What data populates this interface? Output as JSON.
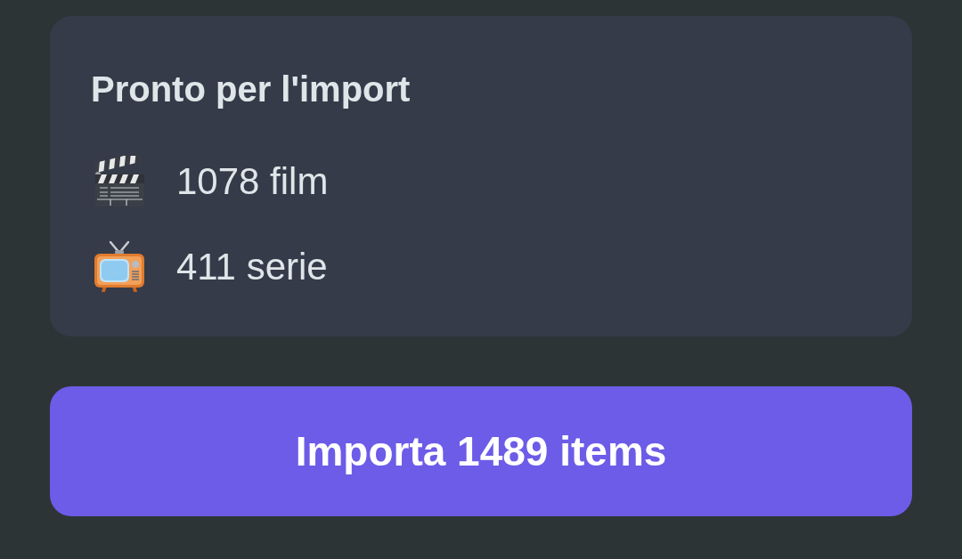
{
  "card": {
    "title": "Pronto per l'import",
    "items": [
      {
        "kind": "movie",
        "label": "1078 film"
      },
      {
        "kind": "tv",
        "label": "411 serie"
      }
    ]
  },
  "button": {
    "label": "Importa 1489 items"
  }
}
